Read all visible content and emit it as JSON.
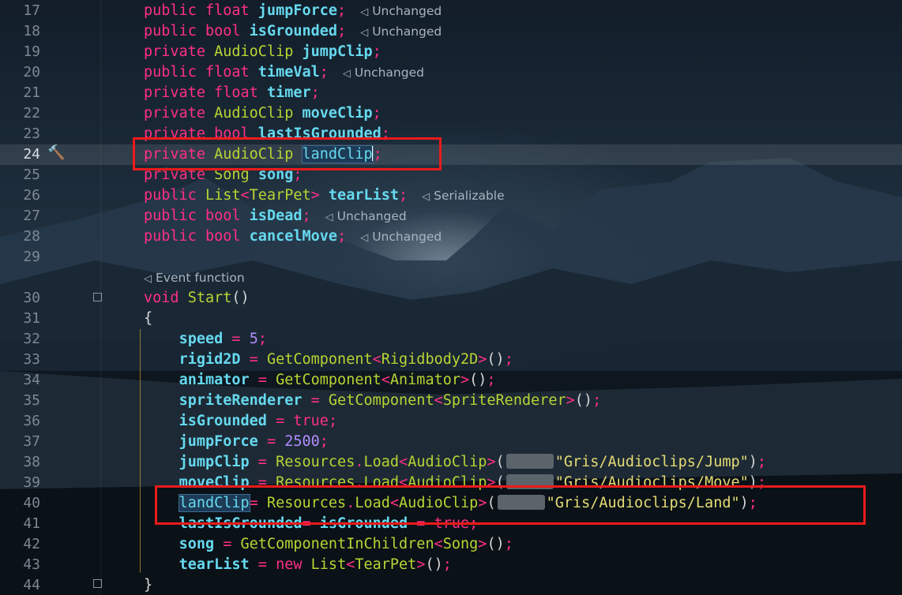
{
  "editor": {
    "lines": [
      {
        "n": "17",
        "tokens": [
          [
            "k",
            "public "
          ],
          [
            "k",
            "float "
          ],
          [
            "v",
            "jumpForce"
          ],
          [
            "p",
            ";"
          ]
        ],
        "hint": "Unchanged"
      },
      {
        "n": "18",
        "tokens": [
          [
            "k",
            "public "
          ],
          [
            "k",
            "bool "
          ],
          [
            "v",
            "isGrounded"
          ],
          [
            "p",
            ";"
          ]
        ],
        "hint": "Unchanged"
      },
      {
        "n": "19",
        "tokens": [
          [
            "k",
            "private "
          ],
          [
            "t",
            "AudioClip "
          ],
          [
            "v",
            "jumpClip"
          ],
          [
            "p",
            ";"
          ]
        ]
      },
      {
        "n": "20",
        "tokens": [
          [
            "k",
            "public "
          ],
          [
            "k",
            "float "
          ],
          [
            "v",
            "timeVal"
          ],
          [
            "p",
            ";"
          ]
        ],
        "hint": "Unchanged"
      },
      {
        "n": "21",
        "tokens": [
          [
            "k",
            "private "
          ],
          [
            "k",
            "float "
          ],
          [
            "v",
            "timer"
          ],
          [
            "p",
            ";"
          ]
        ]
      },
      {
        "n": "22",
        "tokens": [
          [
            "k",
            "private "
          ],
          [
            "t",
            "AudioClip "
          ],
          [
            "v",
            "moveClip"
          ],
          [
            "p",
            ";"
          ]
        ]
      },
      {
        "n": "23",
        "tokens": [
          [
            "k",
            "private "
          ],
          [
            "k",
            "bool "
          ],
          [
            "v",
            "lastIsGrounded"
          ],
          [
            "p",
            ";"
          ]
        ]
      },
      {
        "n": "24",
        "tokens": [
          [
            "k",
            "private "
          ],
          [
            "t",
            "AudioClip "
          ],
          [
            "hlcaret",
            "landClip"
          ],
          [
            "p",
            ";"
          ]
        ],
        "current": true,
        "hammer": true
      },
      {
        "n": "25",
        "tokens": [
          [
            "k",
            "private "
          ],
          [
            "t",
            "Song "
          ],
          [
            "v",
            "song"
          ],
          [
            "p",
            ";"
          ]
        ]
      },
      {
        "n": "26",
        "tokens": [
          [
            "k",
            "public "
          ],
          [
            "t",
            "List"
          ],
          [
            "p",
            "<"
          ],
          [
            "t",
            "TearPet"
          ],
          [
            "p",
            "> "
          ],
          [
            "v",
            "tearList"
          ],
          [
            "p",
            ";"
          ]
        ],
        "hint": "Serializable"
      },
      {
        "n": "27",
        "tokens": [
          [
            "k",
            "public "
          ],
          [
            "k",
            "bool "
          ],
          [
            "v",
            "isDead"
          ],
          [
            "p",
            ";"
          ]
        ],
        "hint": "Unchanged"
      },
      {
        "n": "28",
        "tokens": [
          [
            "k",
            "public "
          ],
          [
            "k",
            "bool "
          ],
          [
            "v",
            "cancelMove"
          ],
          [
            "p",
            ";"
          ]
        ],
        "hint": "Unchanged"
      },
      {
        "n": "29",
        "tokens": []
      },
      {
        "n": "30",
        "tokens": [
          [
            "k",
            "void "
          ],
          [
            "f",
            "Start"
          ],
          [
            "x",
            "()"
          ]
        ],
        "offset": 1
      },
      {
        "n": "31",
        "tokens": [
          [
            "x",
            "{"
          ]
        ],
        "offset": 1
      },
      {
        "n": "32",
        "tokens": [
          [
            "x",
            "    "
          ],
          [
            "v",
            "speed"
          ],
          [
            "p",
            " = "
          ],
          [
            "n",
            "5"
          ],
          [
            "p",
            ";"
          ]
        ],
        "offset": 1
      },
      {
        "n": "33",
        "tokens": [
          [
            "x",
            "    "
          ],
          [
            "v",
            "rigid2D"
          ],
          [
            "p",
            " = "
          ],
          [
            "t",
            "GetComponent"
          ],
          [
            "p",
            "<"
          ],
          [
            "t",
            "Rigidbody2D"
          ],
          [
            "p",
            ">"
          ],
          [
            "x",
            "()"
          ],
          [
            "p",
            ";"
          ]
        ],
        "offset": 1
      },
      {
        "n": "34",
        "tokens": [
          [
            "x",
            "    "
          ],
          [
            "v",
            "animator"
          ],
          [
            "p",
            " = "
          ],
          [
            "t",
            "GetComponent"
          ],
          [
            "p",
            "<"
          ],
          [
            "t",
            "Animator"
          ],
          [
            "p",
            ">"
          ],
          [
            "x",
            "()"
          ],
          [
            "p",
            ";"
          ]
        ],
        "offset": 1
      },
      {
        "n": "35",
        "tokens": [
          [
            "x",
            "    "
          ],
          [
            "v",
            "spriteRenderer"
          ],
          [
            "p",
            " = "
          ],
          [
            "t",
            "GetComponent"
          ],
          [
            "p",
            "<"
          ],
          [
            "t",
            "SpriteRenderer"
          ],
          [
            "p",
            ">"
          ],
          [
            "x",
            "()"
          ],
          [
            "p",
            ";"
          ]
        ],
        "offset": 1
      },
      {
        "n": "36",
        "tokens": [
          [
            "x",
            "    "
          ],
          [
            "v",
            "isGrounded"
          ],
          [
            "p",
            " = "
          ],
          [
            "k",
            "true"
          ],
          [
            "p",
            ";"
          ]
        ],
        "offset": 1
      },
      {
        "n": "37",
        "tokens": [
          [
            "x",
            "    "
          ],
          [
            "v",
            "jumpForce"
          ],
          [
            "p",
            " = "
          ],
          [
            "n",
            "2500"
          ],
          [
            "p",
            ";"
          ]
        ],
        "offset": 1
      },
      {
        "n": "38",
        "tokens": [
          [
            "x",
            "    "
          ],
          [
            "v",
            "jumpClip"
          ],
          [
            "p",
            " = "
          ],
          [
            "t",
            "Resources"
          ],
          [
            "p",
            "."
          ],
          [
            "t",
            "Load"
          ],
          [
            "p",
            "<"
          ],
          [
            "t",
            "AudioClip"
          ],
          [
            "p",
            ">"
          ],
          [
            "x",
            "("
          ],
          [
            "param",
            ""
          ],
          [
            "s",
            "\"Gris/Audioclips/Jump\""
          ],
          [
            "x",
            ")"
          ],
          [
            "p",
            ";"
          ]
        ],
        "offset": 1
      },
      {
        "n": "39",
        "tokens": [
          [
            "x",
            "    "
          ],
          [
            "v",
            "moveClip"
          ],
          [
            "p",
            " = "
          ],
          [
            "t",
            "Resources"
          ],
          [
            "p",
            "."
          ],
          [
            "t",
            "Load"
          ],
          [
            "p",
            "<"
          ],
          [
            "t",
            "AudioClip"
          ],
          [
            "p",
            ">"
          ],
          [
            "x",
            "("
          ],
          [
            "param",
            ""
          ],
          [
            "s",
            "\"Gris/Audioclips/Move\""
          ],
          [
            "x",
            ")"
          ],
          [
            "p",
            ";"
          ]
        ],
        "offset": 1
      },
      {
        "n": "40",
        "tokens": [
          [
            "x",
            "    "
          ],
          [
            "hl",
            "landClip"
          ],
          [
            "p",
            "= "
          ],
          [
            "t",
            "Resources"
          ],
          [
            "p",
            "."
          ],
          [
            "t",
            "Load"
          ],
          [
            "p",
            "<"
          ],
          [
            "t",
            "AudioClip"
          ],
          [
            "p",
            ">"
          ],
          [
            "x",
            "("
          ],
          [
            "param",
            ""
          ],
          [
            "s",
            "\"Gris/Audioclips/Land\""
          ],
          [
            "x",
            ")"
          ],
          [
            "p",
            ";"
          ]
        ],
        "offset": 1
      },
      {
        "n": "41",
        "tokens": [
          [
            "x",
            "    "
          ],
          [
            "v",
            "lastIsGrounded"
          ],
          [
            "p",
            "= "
          ],
          [
            "v",
            "isGrounded"
          ],
          [
            "p",
            " = "
          ],
          [
            "k",
            "true"
          ],
          [
            "p",
            ";"
          ]
        ],
        "offset": 1
      },
      {
        "n": "42",
        "tokens": [
          [
            "x",
            "    "
          ],
          [
            "v",
            "song"
          ],
          [
            "p",
            " = "
          ],
          [
            "t",
            "GetComponentInChildren"
          ],
          [
            "p",
            "<"
          ],
          [
            "t",
            "Song"
          ],
          [
            "p",
            ">"
          ],
          [
            "x",
            "()"
          ],
          [
            "p",
            ";"
          ]
        ],
        "offset": 1
      },
      {
        "n": "43",
        "tokens": [
          [
            "x",
            "    "
          ],
          [
            "v",
            "tearList"
          ],
          [
            "p",
            " = "
          ],
          [
            "k",
            "new "
          ],
          [
            "t",
            "List"
          ],
          [
            "p",
            "<"
          ],
          [
            "t",
            "TearPet"
          ],
          [
            "p",
            ">"
          ],
          [
            "x",
            "()"
          ],
          [
            "p",
            ";"
          ]
        ],
        "offset": 1
      },
      {
        "n": "44",
        "tokens": [
          [
            "x",
            "}"
          ]
        ],
        "offset": 1
      }
    ],
    "event_hint": "Event function",
    "hint_icon": "unity-icon"
  }
}
